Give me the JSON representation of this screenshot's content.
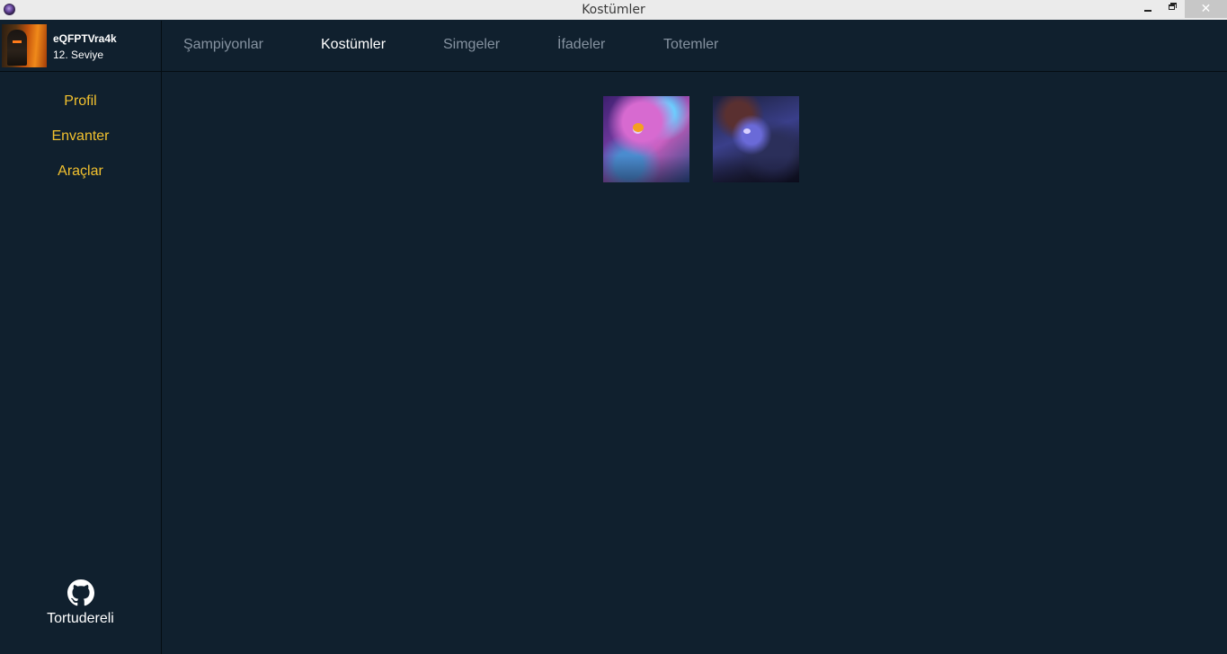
{
  "window": {
    "title": "Kostümler",
    "minimize_glyph": "minimize-icon",
    "maximize_glyph": "restore-icon",
    "close_glyph": "✕"
  },
  "profile": {
    "username": "eQFPTVra4k",
    "level": "12. Seviye"
  },
  "sidebar": {
    "items": [
      {
        "label": "Profil"
      },
      {
        "label": "Envanter"
      },
      {
        "label": "Araçlar"
      }
    ],
    "footer": {
      "icon": "github-icon",
      "label": "Tortudereli"
    }
  },
  "tabs": [
    {
      "label": "Şampiyonlar",
      "active": false
    },
    {
      "label": "Kostümler",
      "active": true
    },
    {
      "label": "Simgeler",
      "active": false
    },
    {
      "label": "İfadeler",
      "active": false
    },
    {
      "label": "Totemler",
      "active": false
    }
  ],
  "skins": [
    {
      "name": "skin-1",
      "palette": "pink-purple"
    },
    {
      "name": "skin-2",
      "palette": "dark-blue"
    }
  ],
  "colors": {
    "background": "#10202e",
    "nav_accent": "#f2c12e",
    "tab_active": "#ffffff",
    "tab_inactive": "#8592a0"
  }
}
